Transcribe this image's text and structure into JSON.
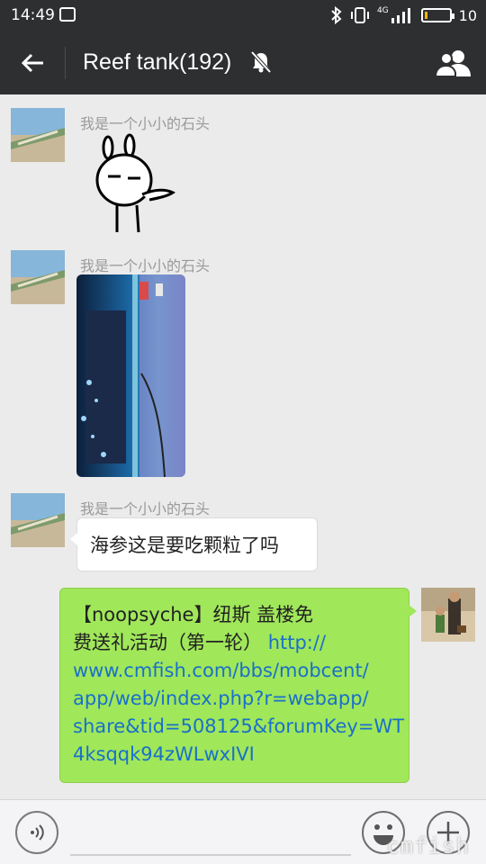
{
  "status_bar": {
    "time": "14:49",
    "network": "4G",
    "battery_level": "10"
  },
  "header": {
    "title": "Reef tank(192)",
    "back_icon": "arrow-left-icon",
    "mute_icon": "bell-off-icon",
    "members_icon": "group-icon"
  },
  "messages": [
    {
      "sender": "我是一个小小的石头",
      "type": "sticker"
    },
    {
      "sender": "我是一个小小的石头",
      "type": "image"
    },
    {
      "sender": "我是一个小小的石头",
      "type": "text",
      "text": "海参这是要吃颗粒了吗"
    },
    {
      "sender": "me",
      "type": "text",
      "line1": "【noopsyche】纽斯 盖楼免",
      "line2_text": "费送礼活动（第一轮）",
      "line2_link": "http://",
      "link_lines": [
        "www.cmfish.com/bbs/mobcent/",
        "app/web/index.php?r=webapp/",
        "share&tid=508125&forumKey=WT",
        "4ksqqk94zWLwxIVI"
      ]
    }
  ],
  "input_bar": {
    "voice_icon": "voice-icon",
    "emoji_icon": "smiley-icon",
    "plus_icon": "plus-icon"
  },
  "watermark": "cmfish",
  "colors": {
    "header_bg": "#2e2f31",
    "chat_bg": "#ebebeb",
    "outgoing_bubble": "#a0e75a",
    "link": "#1a70c9"
  }
}
